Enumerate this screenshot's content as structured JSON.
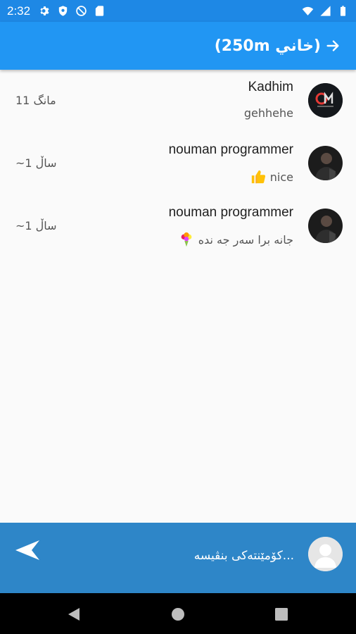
{
  "status_bar": {
    "time": "2:32",
    "left_icons": [
      "gear-icon",
      "shield-icon",
      "no-data-icon",
      "sd-card-icon"
    ],
    "right_icons": [
      "wifi-icon",
      "signal-icon",
      "battery-icon"
    ]
  },
  "app_bar": {
    "title": "(خاني 250m)",
    "back_icon": "arrow-right-icon",
    "background": "#2196f3"
  },
  "comments": [
    {
      "author": "Kadhim",
      "text": "gehhehe",
      "emoji": "",
      "time": "11 مانگ",
      "avatar": "logo-avatar"
    },
    {
      "author": "nouman programmer",
      "text": "nice",
      "emoji": "thumbs-up-icon",
      "time": "~1 ساڵ",
      "avatar": "person-photo-avatar"
    },
    {
      "author": "nouman programmer",
      "text": "جانه برا سەر جه نده",
      "emoji": "bouquet-icon",
      "time": "~1 ساڵ",
      "avatar": "person-photo-avatar"
    }
  ],
  "composer": {
    "placeholder": "...کۆمێنتەکی بنڤیسە",
    "send_icon": "send-icon",
    "avatar": "default-user-icon",
    "background": "#2e86c8"
  },
  "nav_bar": {
    "buttons": [
      "back-triangle-icon",
      "home-circle-icon",
      "recents-square-icon"
    ]
  }
}
